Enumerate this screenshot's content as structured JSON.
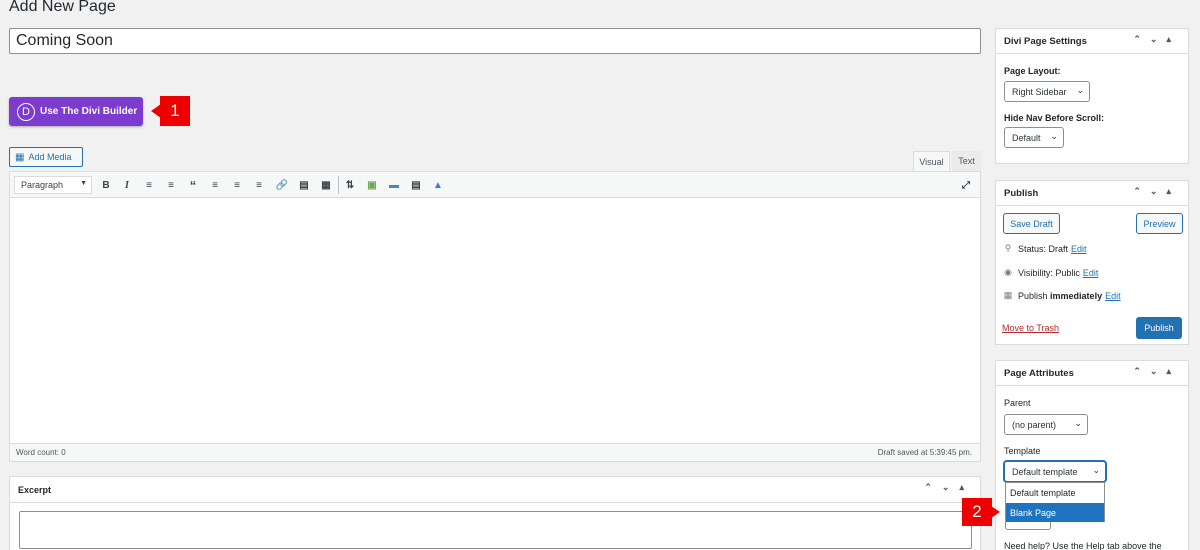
{
  "page": {
    "title": "Add New Page"
  },
  "post_title": {
    "value": "Coming Soon"
  },
  "divi_button": {
    "logo_letter": "D",
    "label": "Use The Divi Builder"
  },
  "callouts": {
    "one": "1",
    "two": "2",
    "color": "#ee0000"
  },
  "media": {
    "add_media_label": "Add Media",
    "icon": "media-icon"
  },
  "editor": {
    "tabs": {
      "visual": "Visual",
      "text": "Text"
    },
    "format_select": "Paragraph",
    "toolbar_icons": [
      "bold-icon",
      "italic-icon",
      "bullet-list-icon",
      "numbered-list-icon",
      "blockquote-icon",
      "align-left-icon",
      "align-center-icon",
      "align-right-icon",
      "link-icon",
      "read-more-icon",
      "toolbar-toggle-icon",
      "divi-shortcode-icon",
      "layout-icon",
      "toggle-icon",
      "divider-icon",
      "lock-icon",
      "fullscreen-icon"
    ],
    "word_count": "Word count: 0",
    "draft_saved": "Draft saved at 5:39:45 pm."
  },
  "excerpt": {
    "title": "Excerpt"
  },
  "divi_settings": {
    "title": "Divi Page Settings",
    "page_layout_label": "Page Layout:",
    "page_layout_value": "Right Sidebar",
    "hide_nav_label": "Hide Nav Before Scroll:",
    "hide_nav_value": "Default"
  },
  "publish": {
    "title": "Publish",
    "save_draft": "Save Draft",
    "preview": "Preview",
    "status_label": "Status:",
    "status_value": "Draft",
    "visibility_label": "Visibility:",
    "visibility_value": "Public",
    "publish_label": "Publish",
    "publish_value": "immediately",
    "edit": "Edit",
    "trash": "Move to Trash",
    "publish_button": "Publish"
  },
  "page_attributes": {
    "title": "Page Attributes",
    "parent_label": "Parent",
    "parent_value": "(no parent)",
    "template_label": "Template",
    "template_value": "Default template",
    "template_options": [
      "Default template",
      "Blank Page"
    ],
    "need_help": "Need help? Use the Help tab above the"
  },
  "colors": {
    "divi_purple": "#7e3bd0",
    "wp_blue": "#2271b1",
    "highlight": "#1e73be"
  }
}
